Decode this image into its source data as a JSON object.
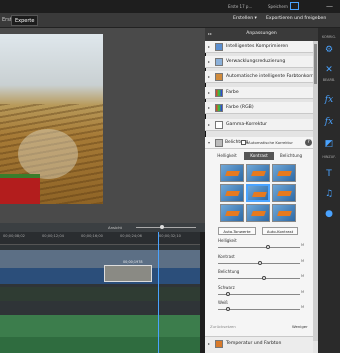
{
  "topbar": {
    "left_label": "Erste",
    "right_label": "Erste 17 p...",
    "save_label": "Speichern"
  },
  "tabs": [
    {
      "label": "Experte",
      "active": true
    }
  ],
  "menu": {
    "create": "Erstellen ▾",
    "share": "Exportieren und freigeben"
  },
  "timeline": {
    "zoom_label": "Ansicht",
    "ruler": [
      "00;00;08;02",
      "00;00;12;04",
      "00;00;16;00",
      "00;00;24;06",
      "00;00;32;10",
      "00;00;40;02"
    ],
    "clip_label": "00;00;1978"
  },
  "adjustments": {
    "title": "Anpassungen",
    "items": [
      {
        "label": "Intelligentes Komprimieren"
      },
      {
        "label": "Verwacklungsreduzierung"
      },
      {
        "label": "Automatische intelligente Farbtonkorrektur"
      },
      {
        "label": "Farbe"
      },
      {
        "label": "Farbe (RGB)"
      },
      {
        "label": "Gamma-Korrektur"
      }
    ],
    "brightness": {
      "title": "Belichtung",
      "auto_label": "Automatische Korrektur",
      "subtabs": [
        "Helligkeit",
        "Kontrast",
        "Belichtung"
      ],
      "active_subtab": 1,
      "auto_tone_btn": "Auto-Tonwerte",
      "auto_contrast_btn": "Auto-Kontrast",
      "sliders": [
        {
          "label": "Helligkeit",
          "value": 0.6
        },
        {
          "label": "Kontrast",
          "value": 0.5
        },
        {
          "label": "Belichtung",
          "value": 0.55
        },
        {
          "label": "Schwarz",
          "value": 0.1
        },
        {
          "label": "Weiß",
          "value": 0.1
        }
      ],
      "reset_label": "Zurücksetzen",
      "less_label": "Weniger"
    },
    "footer_item": "Temperatur und Farbton"
  },
  "rightbar": {
    "top": "KORRIG.",
    "mid": "BEARB.",
    "fx": "EFFEKTE",
    "add": "HINZUF."
  },
  "colors": {
    "accent": "#4aa3ff",
    "panel": "#e4e4e4",
    "dark": "#2b2b2b"
  },
  "icons": [
    "sliders-icon",
    "tools-icon",
    "fx-icon",
    "fx-italic-icon",
    "text-icon",
    "music-icon",
    "circle-icon"
  ]
}
